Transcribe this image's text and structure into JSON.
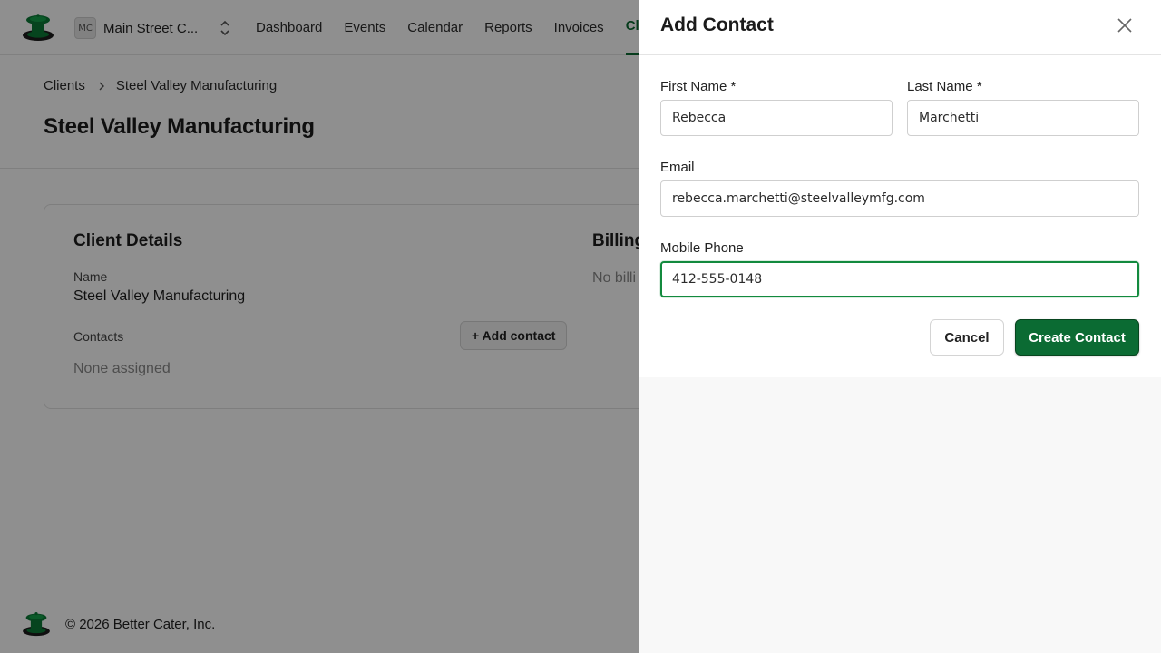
{
  "app": {
    "org": {
      "initials": "MC",
      "name": "Main Street C..."
    },
    "nav": [
      {
        "label": "Dashboard"
      },
      {
        "label": "Events"
      },
      {
        "label": "Calendar"
      },
      {
        "label": "Reports"
      },
      {
        "label": "Invoices"
      },
      {
        "label": "Clients",
        "active": true
      }
    ],
    "breadcrumb": {
      "parent": "Clients",
      "current": "Steel Valley Manufacturing"
    },
    "page_title": "Steel Valley Manufacturing",
    "client_details": {
      "title": "Client Details",
      "name_label": "Name",
      "name_value": "Steel Valley Manufacturing",
      "contacts_label": "Contacts",
      "contacts_empty": "None assigned",
      "add_contact_label": "+ Add contact"
    },
    "billing": {
      "title": "Billing",
      "empty": "No billi"
    },
    "footer": {
      "text": "© 2026 Better Cater, Inc."
    },
    "brand_color": "#0b6b33"
  },
  "drawer": {
    "title": "Add Contact",
    "close_icon": "close-icon",
    "fields": {
      "first_name": {
        "label": "First Name *",
        "value": "Rebecca"
      },
      "last_name": {
        "label": "Last Name *",
        "value": "Marchetti"
      },
      "email": {
        "label": "Email",
        "value": "rebecca.marchetti@steelvalleymfg.com"
      },
      "mobile_phone": {
        "label": "Mobile Phone",
        "value": "412-555-0148",
        "focused": true
      }
    },
    "cancel_label": "Cancel",
    "create_label": "Create Contact",
    "focus_color": "#138a3e"
  }
}
